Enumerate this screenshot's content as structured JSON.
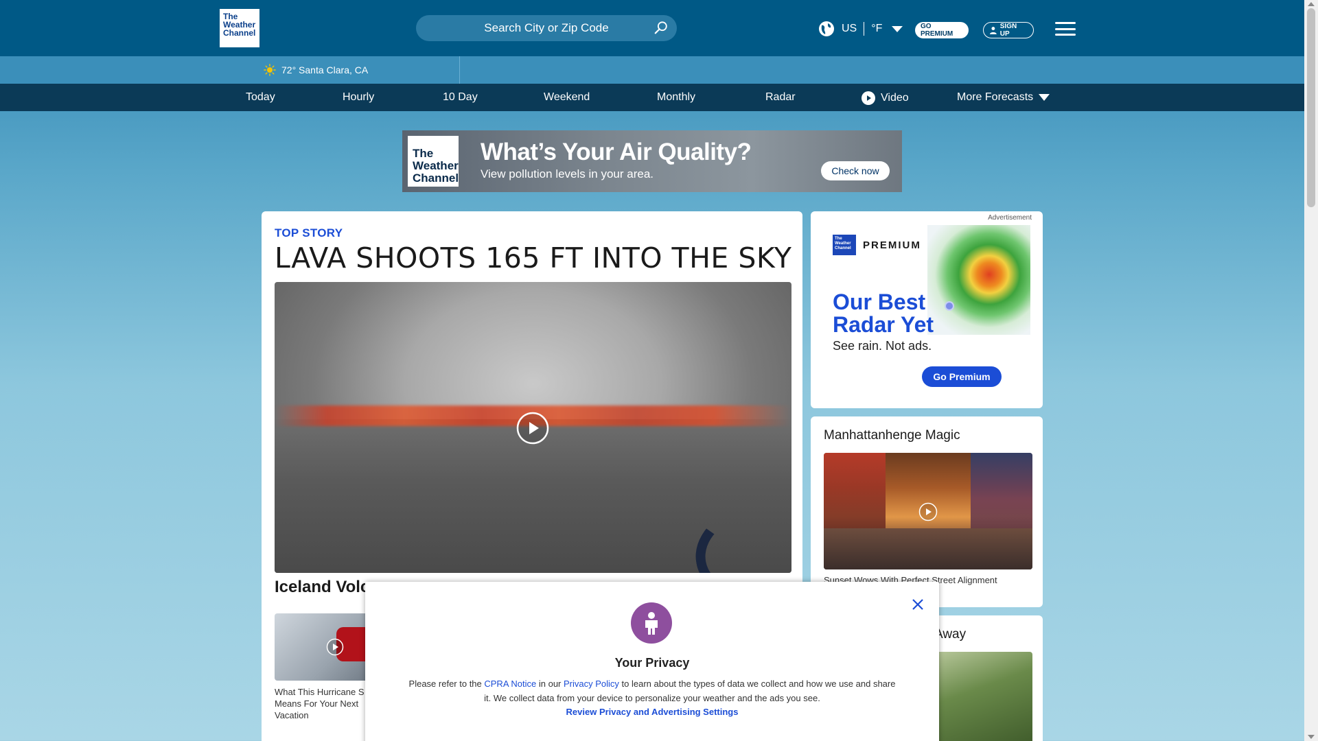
{
  "header": {
    "logo_text": "The Weather Channel",
    "search_placeholder": "Search City or Zip Code",
    "region": "US",
    "units": "°F",
    "premium_label": "GO PREMIUM",
    "signup_label": "SIGN UP"
  },
  "location_bar": {
    "current": "72° Santa Clara, CA"
  },
  "nav": {
    "items": [
      "Today",
      "Hourly",
      "10 Day",
      "Weekend",
      "Monthly",
      "Radar",
      "Video",
      "More Forecasts"
    ]
  },
  "banner": {
    "logo_text": "The Weather Channel",
    "title": "What’s Your Air Quality?",
    "subtitle": "View pollution levels in your area.",
    "button": "Check now"
  },
  "main": {
    "label": "TOP STORY",
    "headline": "LAVA SHOOTS 165 FT INTO THE SKY",
    "subhead": "Iceland Volc",
    "thumb_caption": "What This Hurricane S Means For Your Next Vacation"
  },
  "ad": {
    "label": "Advertisement",
    "brand_small": "The Weather Channel",
    "premium_word": "PREMIUM",
    "title": "Our Best Radar Yet",
    "subtitle": "See rain. Not ads.",
    "button": "Go Premium"
  },
  "side_story": {
    "title": "Manhattanhenge Magic",
    "caption": "Sunset Wows With Perfect Street Alignment"
  },
  "side_story2": {
    "title": "Away"
  },
  "privacy": {
    "title": "Your Privacy",
    "text_pre": "Please refer to the ",
    "cpra": "CPRA Notice",
    "text_mid": " in our ",
    "policy": "Privacy Policy",
    "text_post": " to learn about the types of data we collect and how we use and share it. We collect data from your device to personalize your weather and the ads you see.",
    "link": "Review Privacy and Advertising Settings"
  },
  "colors": {
    "header_bg": "#005986",
    "nav_bg": "#0b3a57",
    "accent_blue": "#1b4dd6"
  }
}
